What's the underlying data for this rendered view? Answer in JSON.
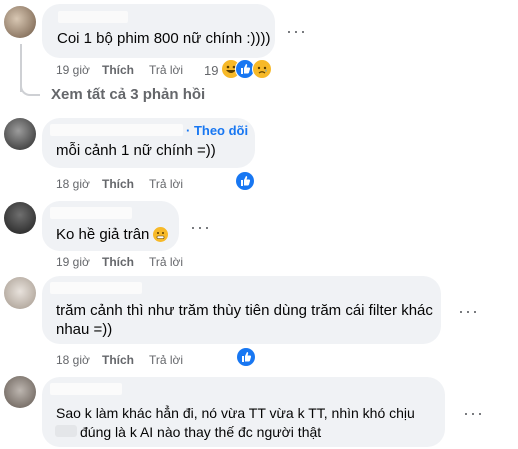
{
  "comments": [
    {
      "text": "Coi 1 bộ phim 800 nữ chính :))))",
      "time": "19 giờ",
      "like": "Thích",
      "reply": "Trả lời",
      "reaction_count": "19",
      "reactions": [
        "haha-icon",
        "like-icon",
        "sad-icon"
      ]
    },
    {
      "text": "mỗi cảnh 1 nữ chính =))",
      "follow": "· Theo dõi",
      "time": "18 giờ",
      "like": "Thích",
      "reply": "Trả lời",
      "reactions": [
        "like-icon"
      ]
    },
    {
      "text": "Ko hề giả trân",
      "time": "19 giờ",
      "like": "Thích",
      "reply": "Trả lời",
      "reactions": []
    },
    {
      "text_line1": "trăm cảnh thì như trăm thùy tiên dùng trăm cái filter khác",
      "text_line2": "nhau =))",
      "time": "18 giờ",
      "like": "Thích",
      "reply": "Trả lời",
      "reactions": [
        "like-icon"
      ]
    },
    {
      "text_line1": "Sao k làm khác hẳn đi, nó vừa TT vừa k TT, nhìn khó chịu",
      "text_line2": "đúng là k AI nào thay thế đc người thật"
    }
  ],
  "view_replies": "Xem tất cả 3 phản hồi",
  "colors": {
    "bubble": "#f0f2f5",
    "meta": "#65676b",
    "link": "#1877f2"
  }
}
